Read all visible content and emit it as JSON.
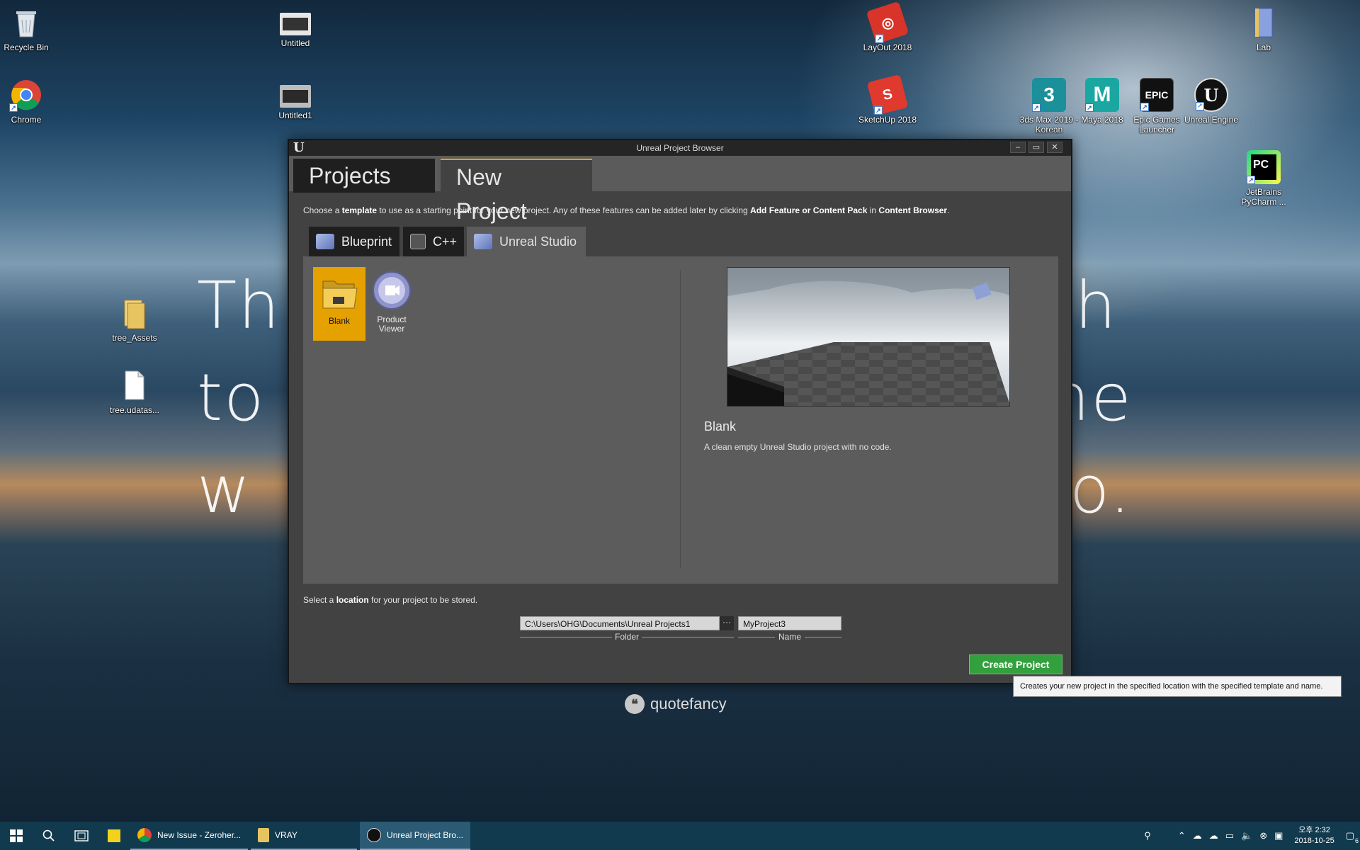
{
  "desktop": {
    "quote_lines": [
      "Th",
      "gh",
      "to",
      "ne",
      "w",
      "o."
    ],
    "icons": [
      {
        "label": "Recycle Bin",
        "icon": "recycle-bin-icon"
      },
      {
        "label": "Chrome",
        "icon": "chrome-icon"
      },
      {
        "label": "Untitled",
        "icon": "file-icon"
      },
      {
        "label": "Untitled1",
        "icon": "file-icon"
      },
      {
        "label": "tree_Assets",
        "icon": "folder-icon"
      },
      {
        "label": "tree.udatas...",
        "icon": "document-icon"
      },
      {
        "label": "LayOut 2018",
        "icon": "layout-icon"
      },
      {
        "label": "SketchUp 2018",
        "icon": "sketchup-icon"
      },
      {
        "label": "3ds Max 2019 - Korean",
        "icon": "3dsmax-icon",
        "glyph": "3"
      },
      {
        "label": "Maya 2018",
        "icon": "maya-icon",
        "glyph": "M"
      },
      {
        "label": "Epic Games Launcher",
        "icon": "epic-games-icon",
        "glyph": "EPIC"
      },
      {
        "label": "Unreal Engine",
        "icon": "unreal-engine-icon",
        "glyph": "U"
      },
      {
        "label": "Lab",
        "icon": "book-icon"
      },
      {
        "label": "JetBrains PyCharm ...",
        "icon": "pycharm-icon",
        "glyph": "PC"
      }
    ],
    "watermark": "quotefancy"
  },
  "window": {
    "title": "Unreal Project Browser",
    "logo": "U",
    "controls": {
      "minimize": "‒",
      "maximize": "▭",
      "close": "✕"
    },
    "tabs": [
      {
        "label": "Projects",
        "active": false
      },
      {
        "label": "New Project",
        "active": true
      }
    ],
    "instruction": {
      "p1": "Choose a ",
      "b1": "template",
      "p2": " to use as a starting point for your new project.  Any of these features can be added later by clicking ",
      "b2": "Add Feature or Content Pack",
      "p3": " in ",
      "b3": "Content Browser",
      "p4": "."
    },
    "subtabs": [
      {
        "label": "Blueprint",
        "icon": "blueprint-icon"
      },
      {
        "label": "C++",
        "icon": "cpp-icon"
      },
      {
        "label": "Unreal Studio",
        "icon": "blueprint-icon",
        "active": true
      }
    ],
    "templates": [
      {
        "label": "Blank",
        "selected": true,
        "icon": "folder-icon"
      },
      {
        "label": "Product Viewer",
        "selected": false,
        "icon": "product-viewer-icon"
      }
    ],
    "preview": {
      "title": "Blank",
      "description": "A clean empty Unreal Studio project with no code."
    },
    "location": {
      "p1": "Select a ",
      "b1": "location",
      "p2": " for your project to be stored.",
      "folder_value": "C:\\Users\\OHG\\Documents\\Unreal Projects1",
      "browse": "···",
      "name_value": "MyProject3",
      "folder_label": "Folder",
      "name_label": "Name"
    },
    "create_button": "Create Project",
    "tooltip": "Creates your new project in the specified location with the specified template and name."
  },
  "taskbar": {
    "apps": [
      {
        "label": "New Issue - Zeroher...",
        "icon": "chrome-icon"
      },
      {
        "label": "VRAY",
        "icon": "folder-icon"
      },
      {
        "label": "Unreal Project Bro...",
        "icon": "unreal-engine-icon",
        "active": true
      }
    ],
    "time": "오후 2:32",
    "date": "2018-10-25",
    "notifications": "6"
  },
  "colors": {
    "accent": "#e5a100",
    "create_button": "#32a03c",
    "window_bg": "#424242",
    "panel_bg": "#5c5c5c",
    "taskbar_bg": "#123a4e"
  }
}
